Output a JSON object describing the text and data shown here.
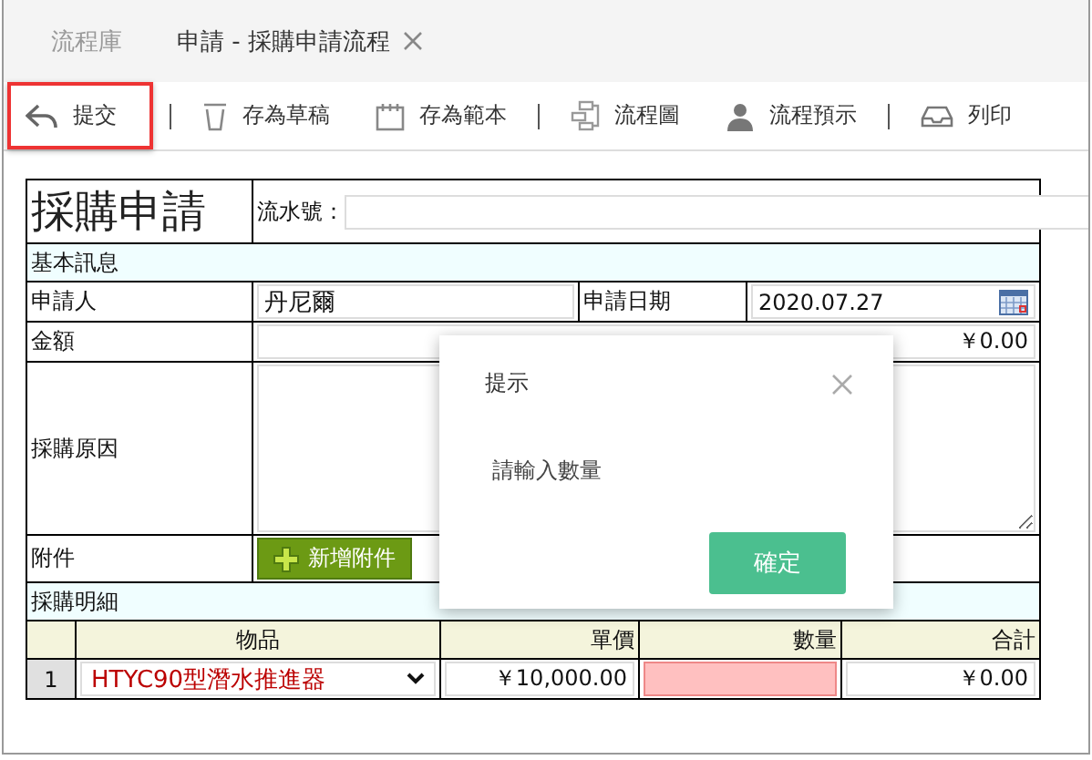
{
  "tabs": [
    {
      "label": "流程庫",
      "selected": false,
      "closable": false
    },
    {
      "label": "申請 - 採購申請流程",
      "selected": true,
      "closable": true
    }
  ],
  "toolbar": {
    "groups": [
      [
        {
          "label": "提交",
          "kind": "reply",
          "highlighted": true
        }
      ],
      [
        {
          "label": "存為草稿",
          "kind": "cup",
          "highlighted": false
        },
        {
          "label": "存為範本",
          "kind": "calendar",
          "highlighted": false
        }
      ],
      [
        {
          "label": "流程圖",
          "kind": "flow",
          "highlighted": false
        },
        {
          "label": "流程預示",
          "kind": "person",
          "highlighted": false
        }
      ],
      [
        {
          "label": "列印",
          "kind": "tray",
          "highlighted": false
        }
      ]
    ]
  },
  "form": {
    "title": "採購申請",
    "serial_label": "流水號：",
    "basic_section": "基本訊息",
    "applicant": {
      "label": "申請人",
      "value": "丹尼爾"
    },
    "apply_date": {
      "label": "申請日期",
      "value": "2020.07.27"
    },
    "amount": {
      "label": "金額",
      "value": "￥0.00"
    },
    "reason": {
      "label": "採購原因"
    },
    "attachment": {
      "label": "附件",
      "button": "新增附件"
    },
    "detail_section": "採購明細",
    "detail_columns": [
      "物品",
      "單價",
      "數量",
      "合計"
    ],
    "detail_rows": [
      {
        "index": "1",
        "item": "HTYC90型潛水推進器",
        "price": "￥10,000.00",
        "quantity_invalid": true,
        "total": "￥0.00"
      }
    ]
  },
  "dialog": {
    "title": "提示",
    "message": "請輸入數量",
    "button": "確定"
  }
}
